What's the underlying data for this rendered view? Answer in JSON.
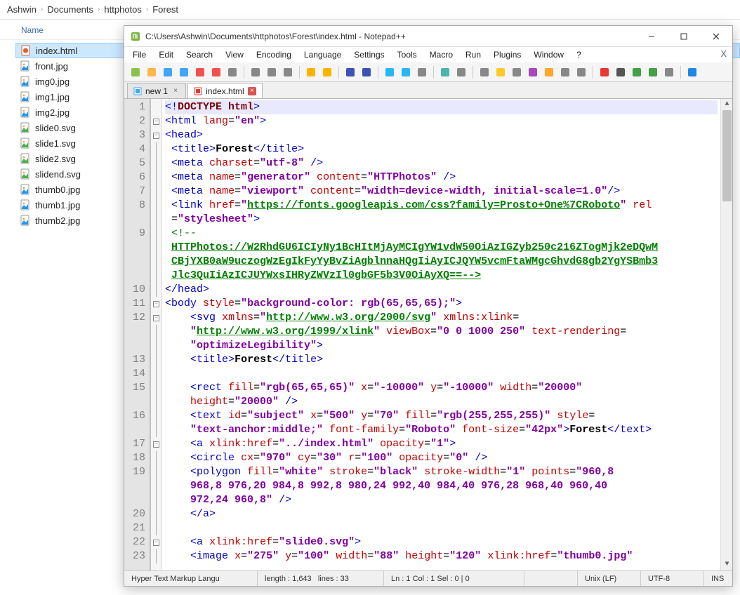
{
  "breadcrumb": [
    "Ashwin",
    "Documents",
    "httphotos",
    "Forest"
  ],
  "explorer": {
    "column": "Name",
    "files": [
      {
        "name": "index.html",
        "type": "html",
        "selected": true
      },
      {
        "name": "front.jpg",
        "type": "img"
      },
      {
        "name": "img0.jpg",
        "type": "img"
      },
      {
        "name": "img1.jpg",
        "type": "img"
      },
      {
        "name": "img2.jpg",
        "type": "img"
      },
      {
        "name": "slide0.svg",
        "type": "svg"
      },
      {
        "name": "slide1.svg",
        "type": "svg"
      },
      {
        "name": "slide2.svg",
        "type": "svg"
      },
      {
        "name": "slidend.svg",
        "type": "svg"
      },
      {
        "name": "thumb0.jpg",
        "type": "img"
      },
      {
        "name": "thumb1.jpg",
        "type": "img"
      },
      {
        "name": "thumb2.jpg",
        "type": "img"
      }
    ]
  },
  "npp": {
    "title": "C:\\Users\\Ashwin\\Documents\\httphotos\\Forest\\index.html - Notepad++",
    "menus": [
      "File",
      "Edit",
      "Search",
      "View",
      "Encoding",
      "Language",
      "Settings",
      "Tools",
      "Macro",
      "Run",
      "Plugins",
      "Window",
      "?"
    ],
    "tabs": [
      {
        "label": "new 1",
        "active": false,
        "dirty": false
      },
      {
        "label": "index.html",
        "active": true,
        "dirty": true
      }
    ],
    "toolbar_icons": [
      "new-file",
      "open",
      "save",
      "save-all",
      "close",
      "close-all",
      "print",
      "",
      "cut",
      "copy",
      "paste",
      "",
      "undo",
      "redo",
      "",
      "find",
      "replace",
      "",
      "zoom-in",
      "zoom-out",
      "sync",
      "",
      "wordwrap",
      "guides",
      "",
      "indent",
      "highlight",
      "user-lang",
      "func",
      "folder",
      "doc-map",
      "monitor",
      "",
      "record",
      "stop",
      "play",
      "play-multi",
      "save-macro",
      "",
      "spellcheck"
    ],
    "code": {
      "lines": [
        {
          "n": 1,
          "fold": "",
          "html": "<span class='c-ang'>&lt;!</span><span class='c-pi'>DOCTYPE html</span><span class='c-ang'>&gt;</span>",
          "hl": true
        },
        {
          "n": 2,
          "fold": "box",
          "html": "<span class='c-ang'>&lt;</span><span class='c-tag'>html</span> <span class='c-attr'>lang</span><span class='c-eq'>=</span><span class='c-val'>\"en\"</span><span class='c-ang'>&gt;</span>"
        },
        {
          "n": 3,
          "fold": "box",
          "html": "<span class='c-ang'>&lt;</span><span class='c-tag'>head</span><span class='c-ang'>&gt;</span>"
        },
        {
          "n": 4,
          "fold": "bar",
          "html": " <span class='c-ang'>&lt;</span><span class='c-tag'>title</span><span class='c-ang'>&gt;</span><span class='c-text'>Forest</span><span class='c-ang'>&lt;/</span><span class='c-tag'>title</span><span class='c-ang'>&gt;</span>"
        },
        {
          "n": 5,
          "fold": "bar",
          "html": " <span class='c-ang'>&lt;</span><span class='c-tag'>meta</span> <span class='c-attr'>charset</span><span class='c-eq'>=</span><span class='c-val'>\"utf-8\"</span> <span class='c-ang'>/&gt;</span>"
        },
        {
          "n": 6,
          "fold": "bar",
          "html": " <span class='c-ang'>&lt;</span><span class='c-tag'>meta</span> <span class='c-attr'>name</span><span class='c-eq'>=</span><span class='c-val'>\"generator\"</span> <span class='c-attr'>content</span><span class='c-eq'>=</span><span class='c-val'>\"HTTPhotos\"</span> <span class='c-ang'>/&gt;</span>"
        },
        {
          "n": 7,
          "fold": "bar",
          "html": " <span class='c-ang'>&lt;</span><span class='c-tag'>meta</span> <span class='c-attr'>name</span><span class='c-eq'>=</span><span class='c-val'>\"viewport\"</span> <span class='c-attr'>content</span><span class='c-eq'>=</span><span class='c-val'>\"width=device-width, initial-scale=1.0\"</span><span class='c-ang'>/&gt;</span>"
        },
        {
          "n": 8,
          "fold": "bar",
          "html": " <span class='c-ang'>&lt;</span><span class='c-tag'>link</span> <span class='c-attr'>href</span><span class='c-eq'>=</span><span class='c-val'>\"<span class='c-url'>https://fonts.googleapis.com/css?family=Prosto+One%7CRoboto</span>\"</span> <span class='c-attr'>rel</span>"
        },
        {
          "n": "",
          "fold": "bar",
          "html": " <span class='c-eq'>=</span><span class='c-val'>\"stylesheet\"</span><span class='c-ang'>&gt;</span>"
        },
        {
          "n": 9,
          "fold": "bar",
          "html": " <span class='c-com'>&lt;!--</span>"
        },
        {
          "n": "",
          "fold": "bar",
          "html": " <span class='c-url'>HTTPhotos://W2RhdGU6ICIyNy1BcHItMjAyMCIgYW1vdW50OiAzIGZyb250c216ZTogMjk2eDQwM</span>"
        },
        {
          "n": "",
          "fold": "bar",
          "html": " <span class='c-url'>CBjYXB0aW9uczogWzEgIkFyYyBvZiAgblnnaHQgIiAyICJQYW5vcmFtaWMgcGhvdG8gb2YgYSBmb3</span>"
        },
        {
          "n": "",
          "fold": "bar",
          "html": " <span class='c-url'>Jlc3QuIiAzICJUYWxsIHRyZWVzIl0gbGF5b3V0OiAyXQ==--&gt;</span>"
        },
        {
          "n": 10,
          "fold": "bar",
          "html": "<span class='c-ang'>&lt;/</span><span class='c-tag'>head</span><span class='c-ang'>&gt;</span>"
        },
        {
          "n": 11,
          "fold": "box",
          "html": "<span class='c-ang'>&lt;</span><span class='c-tag'>body</span> <span class='c-attr'>style</span><span class='c-eq'>=</span><span class='c-val'>\"background-color: rgb(65,65,65);\"</span><span class='c-ang'>&gt;</span>"
        },
        {
          "n": 12,
          "fold": "box",
          "html": "    <span class='c-ang'>&lt;</span><span class='c-tag'>svg</span> <span class='c-attr'>xmlns</span><span class='c-eq'>=</span><span class='c-val'>\"<span class='c-url'>http://www.w3.org/2000/svg</span>\"</span> <span class='c-attr'>xmlns:xlink</span><span class='c-eq'>=</span>"
        },
        {
          "n": "",
          "fold": "bar",
          "html": "    <span class='c-val'>\"<span class='c-url'>http://www.w3.org/1999/xlink</span>\"</span> <span class='c-attr'>viewBox</span><span class='c-eq'>=</span><span class='c-val'>\"0 0 1000 250\"</span> <span class='c-attr'>text-rendering</span><span class='c-eq'>=</span>"
        },
        {
          "n": "",
          "fold": "bar",
          "html": "    <span class='c-val'>\"optimizeLegibility\"</span><span class='c-ang'>&gt;</span>"
        },
        {
          "n": 13,
          "fold": "bar",
          "html": "    <span class='c-ang'>&lt;</span><span class='c-tag'>title</span><span class='c-ang'>&gt;</span><span class='c-text'>Forest</span><span class='c-ang'>&lt;/</span><span class='c-tag'>title</span><span class='c-ang'>&gt;</span>"
        },
        {
          "n": 14,
          "fold": "bar",
          "html": ""
        },
        {
          "n": 15,
          "fold": "bar",
          "html": "    <span class='c-ang'>&lt;</span><span class='c-tag'>rect</span> <span class='c-attr'>fill</span><span class='c-eq'>=</span><span class='c-val'>\"rgb(65,65,65)\"</span> <span class='c-attr'>x</span><span class='c-eq'>=</span><span class='c-val'>\"-10000\"</span> <span class='c-attr'>y</span><span class='c-eq'>=</span><span class='c-val'>\"-10000\"</span> <span class='c-attr'>width</span><span class='c-eq'>=</span><span class='c-val'>\"20000\"</span>"
        },
        {
          "n": "",
          "fold": "bar",
          "html": "    <span class='c-attr'>height</span><span class='c-eq'>=</span><span class='c-val'>\"20000\"</span> <span class='c-ang'>/&gt;</span>"
        },
        {
          "n": 16,
          "fold": "bar",
          "html": "    <span class='c-ang'>&lt;</span><span class='c-tag'>text</span> <span class='c-attr'>id</span><span class='c-eq'>=</span><span class='c-val'>\"subject\"</span> <span class='c-attr'>x</span><span class='c-eq'>=</span><span class='c-val'>\"500\"</span> <span class='c-attr'>y</span><span class='c-eq'>=</span><span class='c-val'>\"70\"</span> <span class='c-attr'>fill</span><span class='c-eq'>=</span><span class='c-val'>\"rgb(255,255,255)\"</span> <span class='c-attr'>style</span><span class='c-eq'>=</span>"
        },
        {
          "n": "",
          "fold": "bar",
          "html": "    <span class='c-val'>\"text-anchor:middle;\"</span> <span class='c-attr'>font-family</span><span class='c-eq'>=</span><span class='c-val'>\"Roboto\"</span> <span class='c-attr'>font-size</span><span class='c-eq'>=</span><span class='c-val'>\"42px\"</span><span class='c-ang'>&gt;</span><span class='c-text'>Forest</span><span class='c-ang'>&lt;/</span><span class='c-tag'>text</span><span class='c-ang'>&gt;</span>"
        },
        {
          "n": 17,
          "fold": "box",
          "html": "    <span class='c-ang'>&lt;</span><span class='c-tag'>a</span> <span class='c-attr'>xlink:href</span><span class='c-eq'>=</span><span class='c-val'>\"../index.html\"</span> <span class='c-attr'>opacity</span><span class='c-eq'>=</span><span class='c-val'>\"1\"</span><span class='c-ang'>&gt;</span>"
        },
        {
          "n": 18,
          "fold": "bar",
          "html": "    <span class='c-ang'>&lt;</span><span class='c-tag'>circle</span> <span class='c-attr'>cx</span><span class='c-eq'>=</span><span class='c-val'>\"970\"</span> <span class='c-attr'>cy</span><span class='c-eq'>=</span><span class='c-val'>\"30\"</span> <span class='c-attr'>r</span><span class='c-eq'>=</span><span class='c-val'>\"100\"</span> <span class='c-attr'>opacity</span><span class='c-eq'>=</span><span class='c-val'>\"0\"</span> <span class='c-ang'>/&gt;</span>"
        },
        {
          "n": 19,
          "fold": "bar",
          "html": "    <span class='c-ang'>&lt;</span><span class='c-tag'>polygon</span> <span class='c-attr'>fill</span><span class='c-eq'>=</span><span class='c-val'>\"white\"</span> <span class='c-attr'>stroke</span><span class='c-eq'>=</span><span class='c-val'>\"black\"</span> <span class='c-attr'>stroke-width</span><span class='c-eq'>=</span><span class='c-val'>\"1\"</span> <span class='c-attr'>points</span><span class='c-eq'>=</span><span class='c-val'>\"960,8</span>"
        },
        {
          "n": "",
          "fold": "bar",
          "html": "    <span class='c-val'>968,8 976,20 984,8 992,8 980,24 992,40 984,40 976,28 968,40 960,40</span>"
        },
        {
          "n": "",
          "fold": "bar",
          "html": "    <span class='c-val'>972,24 960,8\"</span> <span class='c-ang'>/&gt;</span>"
        },
        {
          "n": 20,
          "fold": "bar",
          "html": "    <span class='c-ang'>&lt;/</span><span class='c-tag'>a</span><span class='c-ang'>&gt;</span>"
        },
        {
          "n": 21,
          "fold": "bar",
          "html": ""
        },
        {
          "n": 22,
          "fold": "box",
          "html": "    <span class='c-ang'>&lt;</span><span class='c-tag'>a</span> <span class='c-attr'>xlink:href</span><span class='c-eq'>=</span><span class='c-val'>\"slide0.svg\"</span><span class='c-ang'>&gt;</span>"
        },
        {
          "n": 23,
          "fold": "bar",
          "html": "    <span class='c-ang'>&lt;</span><span class='c-tag'>image</span> <span class='c-attr'>x</span><span class='c-eq'>=</span><span class='c-val'>\"275\"</span> <span class='c-attr'>y</span><span class='c-eq'>=</span><span class='c-val'>\"100\"</span> <span class='c-attr'>width</span><span class='c-eq'>=</span><span class='c-val'>\"88\"</span> <span class='c-attr'>height</span><span class='c-eq'>=</span><span class='c-val'>\"120\"</span> <span class='c-attr'>xlink:href</span><span class='c-eq'>=</span><span class='c-val'>\"thumb0.jpg\"</span>"
        }
      ]
    },
    "status": {
      "lang": "Hyper Text Markup Langu",
      "length": "length : 1,643",
      "lines": "lines : 33",
      "pos": "Ln : 1   Col : 1   Sel : 0 | 0",
      "eol": "Unix (LF)",
      "enc": "UTF-8",
      "mode": "INS"
    }
  }
}
